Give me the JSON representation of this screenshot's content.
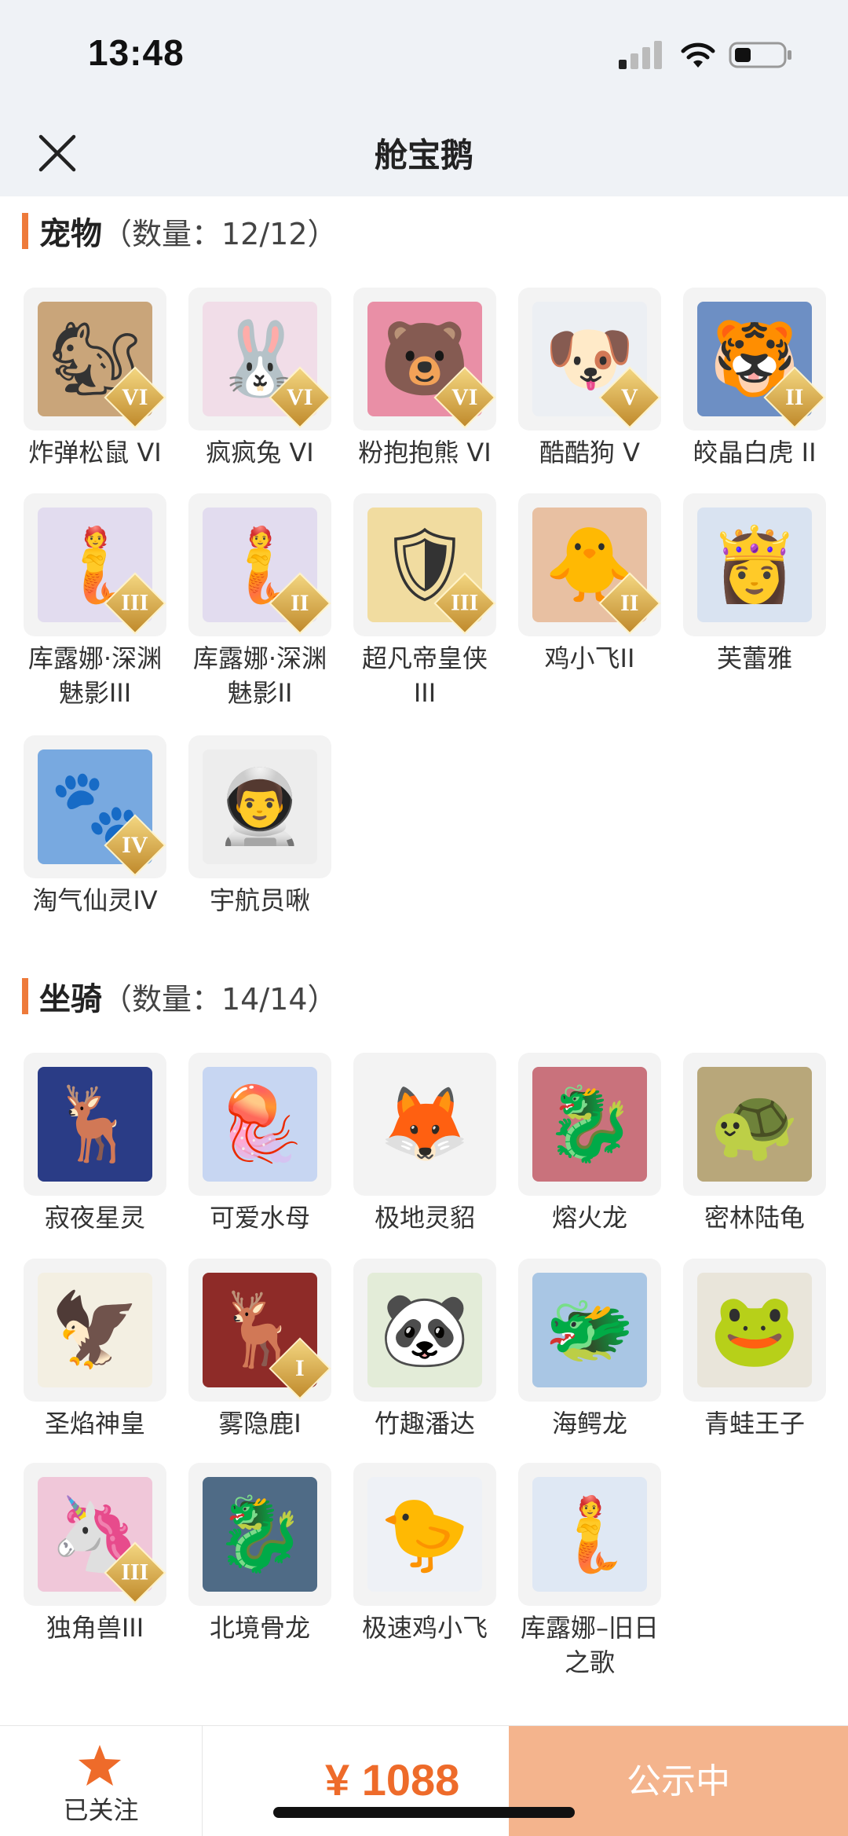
{
  "status_bar": {
    "time": "13:48"
  },
  "nav": {
    "title": "舱宝鹅",
    "close_icon": "close-icon"
  },
  "pets": {
    "title": "宠物",
    "count": "（数量：12/12）",
    "items": [
      {
        "name": "炸弹松鼠 VI",
        "badge": "VI",
        "icon": "squirrel",
        "bg": "#c9a57a",
        "glyph": "🐿"
      },
      {
        "name": "疯疯兔 VI",
        "badge": "VI",
        "icon": "rabbit",
        "bg": "#f1dde8",
        "glyph": "🐰"
      },
      {
        "name": "粉抱抱熊 VI",
        "badge": "VI",
        "icon": "bear",
        "bg": "#e98fa6",
        "glyph": "🐻"
      },
      {
        "name": "酷酷狗 V",
        "badge": "V",
        "icon": "dog",
        "bg": "#eceff3",
        "glyph": "🐶"
      },
      {
        "name": "皎晶白虎 II",
        "badge": "II",
        "icon": "tiger",
        "bg": "#6d8fc4",
        "glyph": "🐯"
      },
      {
        "name": "库露娜·深渊魅影III",
        "badge": "III",
        "icon": "mermaid",
        "bg": "#e2dcef",
        "glyph": "🧜"
      },
      {
        "name": "库露娜·深渊魅影II",
        "badge": "II",
        "icon": "mermaid",
        "bg": "#e2dcef",
        "glyph": "🧜"
      },
      {
        "name": "超凡帝皇侠III",
        "badge": "III",
        "icon": "knight",
        "bg": "#f1dca0",
        "glyph": "🛡"
      },
      {
        "name": "鸡小飞II",
        "badge": "II",
        "icon": "chick",
        "bg": "#e8c0a2",
        "glyph": "🐥"
      },
      {
        "name": "芙蕾雅",
        "badge": "",
        "icon": "valkyrie",
        "bg": "#d9e3f1",
        "glyph": "👸"
      },
      {
        "name": "淘气仙灵IV",
        "badge": "IV",
        "icon": "fairy-dog",
        "bg": "#78a9e0",
        "glyph": "🐾"
      },
      {
        "name": "宇航员啾",
        "badge": "",
        "icon": "astronaut",
        "bg": "#ededed",
        "glyph": "👨‍🚀"
      }
    ]
  },
  "mounts": {
    "title": "坐骑",
    "count": "（数量：14/14）",
    "items": [
      {
        "name": "寂夜星灵",
        "badge": "",
        "icon": "star-spirit",
        "bg": "#2a3c86",
        "glyph": "🦌"
      },
      {
        "name": "可爱水母",
        "badge": "",
        "icon": "jellyfish",
        "bg": "#c7d6f2",
        "glyph": "🪼"
      },
      {
        "name": "极地灵貂",
        "badge": "",
        "icon": "polar-mink",
        "bg": "#f3f3f3",
        "glyph": "🦊"
      },
      {
        "name": "熔火龙",
        "badge": "",
        "icon": "fire-dragon",
        "bg": "#c9727c",
        "glyph": "🐉"
      },
      {
        "name": "密林陆龟",
        "badge": "",
        "icon": "turtle",
        "bg": "#b8a77a",
        "glyph": "🐢"
      },
      {
        "name": "圣焰神皇",
        "badge": "",
        "icon": "phoenix",
        "bg": "#f3efe2",
        "glyph": "🦅"
      },
      {
        "name": "雾隐鹿I",
        "badge": "I",
        "icon": "deer",
        "bg": "#8e2b28",
        "glyph": "🦌"
      },
      {
        "name": "竹趣潘达",
        "badge": "",
        "icon": "panda",
        "bg": "#e3ecd8",
        "glyph": "🐼"
      },
      {
        "name": "海鳄龙",
        "badge": "",
        "icon": "sea-dragon",
        "bg": "#a9c6e4",
        "glyph": "🐲"
      },
      {
        "name": "青蛙王子",
        "badge": "",
        "icon": "frog",
        "bg": "#e9e5da",
        "glyph": "🐸"
      },
      {
        "name": "独角兽III",
        "badge": "III",
        "icon": "unicorn",
        "bg": "#f0c7d9",
        "glyph": "🦄"
      },
      {
        "name": "北境骨龙",
        "badge": "",
        "icon": "bone-dragon",
        "bg": "#4f6b86",
        "glyph": "🐉"
      },
      {
        "name": "极速鸡小飞",
        "badge": "",
        "icon": "chick",
        "bg": "#eef1f6",
        "glyph": "🐤"
      },
      {
        "name": "库露娜–旧日之歌",
        "badge": "",
        "icon": "mermaid",
        "bg": "#dfe8f4",
        "glyph": "🧜"
      }
    ]
  },
  "bottom": {
    "follow_label": "已关注",
    "price": "¥ 1088",
    "status_label": "公示中",
    "accent": "#ee6b2a"
  }
}
